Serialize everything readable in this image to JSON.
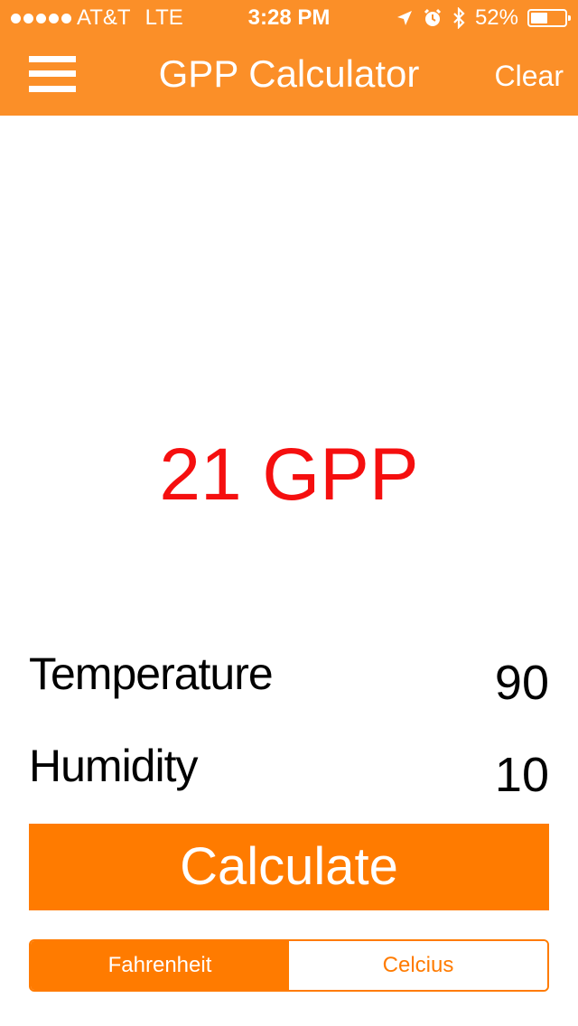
{
  "status_bar": {
    "carrier": "AT&T",
    "network": "LTE",
    "time": "3:28 PM",
    "battery": "52%",
    "battery_level": 0.52
  },
  "nav": {
    "title": "GPP Calculator",
    "clear_label": "Clear"
  },
  "result": {
    "text": "21 GPP",
    "color": "#f50f0f"
  },
  "inputs": {
    "temperature_label": "Temperature",
    "temperature_value": "90",
    "humidity_label": "Humidity",
    "humidity_value": "10"
  },
  "calculate_label": "Calculate",
  "unit_toggle": {
    "options": [
      "Fahrenheit",
      "Celcius"
    ],
    "selected": "Fahrenheit"
  },
  "colors": {
    "header": "#fb8f28",
    "accent": "#ff7b00"
  }
}
